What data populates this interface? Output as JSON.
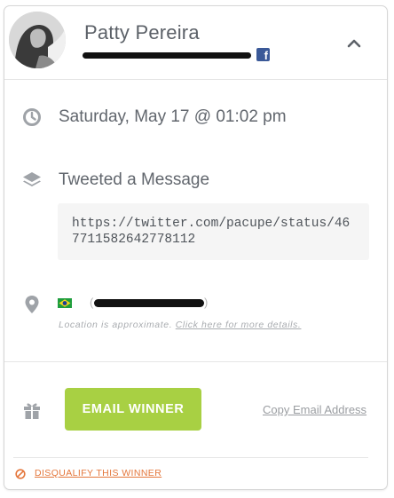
{
  "user": {
    "name": "Patty Pereira",
    "email_hint": "",
    "social_network_icon": "facebook-icon"
  },
  "entry": {
    "date": "Saturday, May 17 @ 01:02 pm",
    "action": "Tweeted a Message",
    "message_url": "https://twitter.com/pacupe/status/467711582642778112"
  },
  "location": {
    "flag": "brazil-flag",
    "note_prefix": "Location is approximate.",
    "note_link": "Click here for more details."
  },
  "actions": {
    "email_button": "EMAIL WINNER",
    "copy_email": "Copy Email Address",
    "disqualify": "DISQUALIFY THIS WINNER"
  },
  "colors": {
    "accent_green": "#a8d043",
    "facebook_blue": "#3b5998",
    "danger_orange": "#e4763b",
    "icon_gray": "#9fa3a8"
  }
}
